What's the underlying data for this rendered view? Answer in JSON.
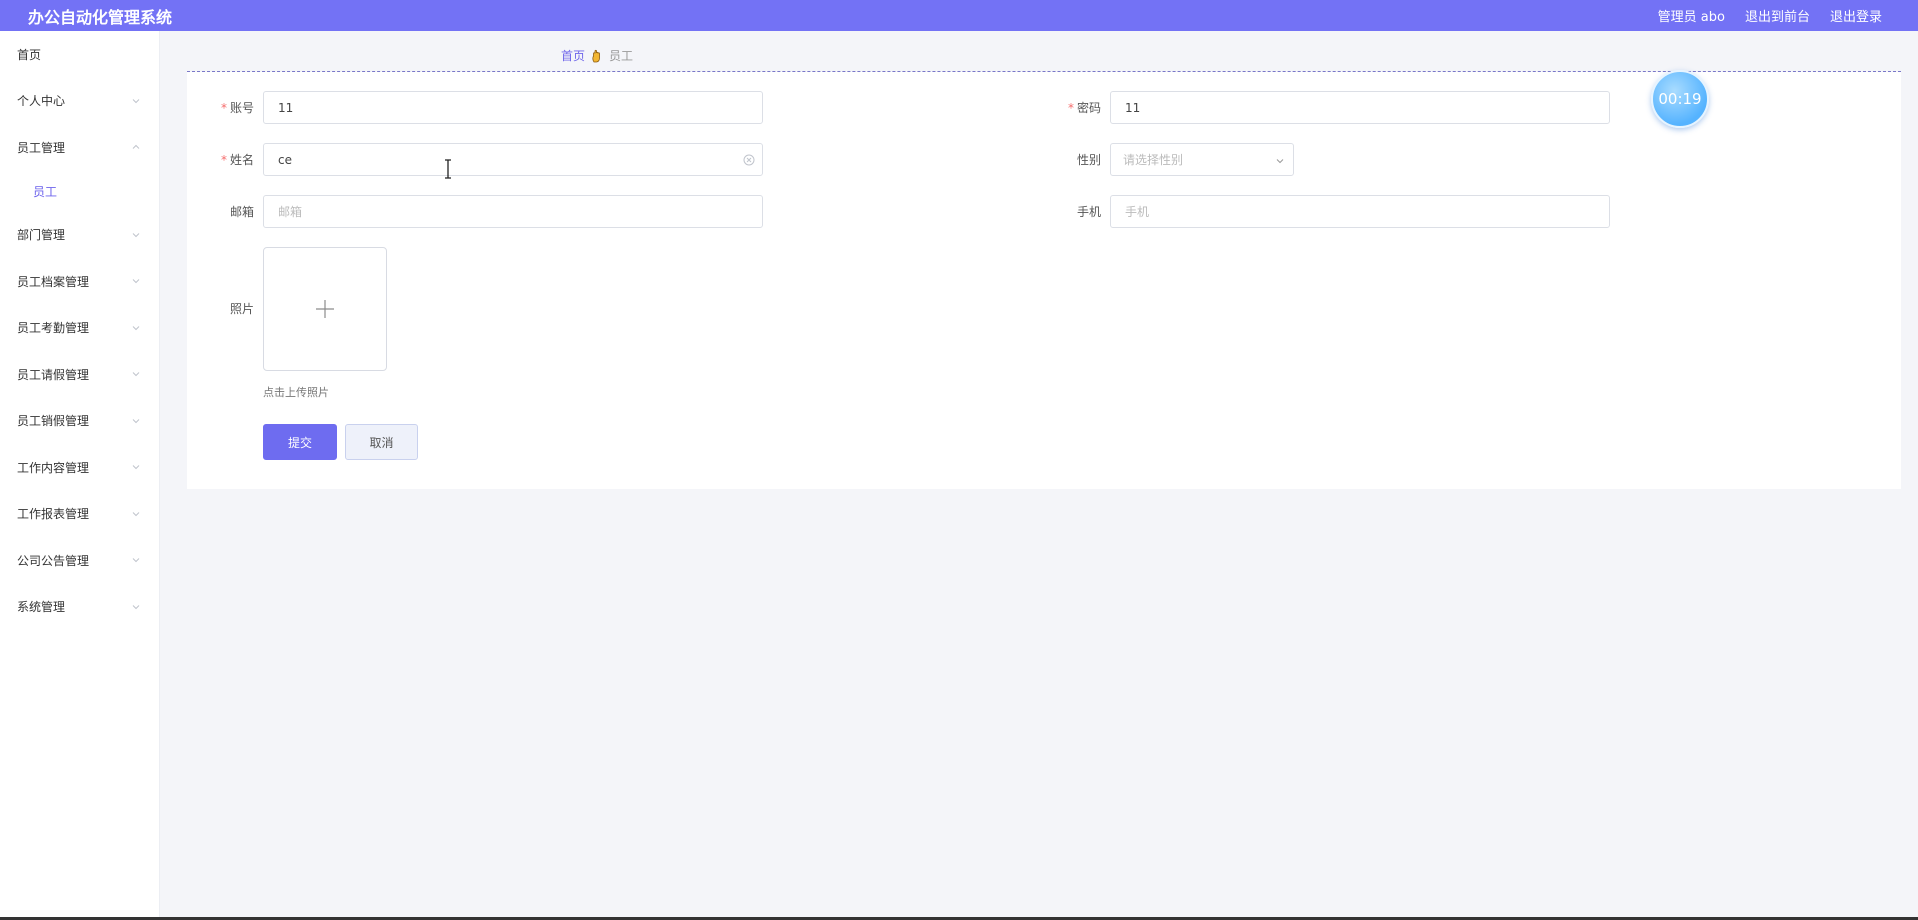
{
  "header": {
    "app_title": "办公自动化管理系统",
    "user_label": "管理员 abo",
    "to_frontend": "退出到前台",
    "logout": "退出登录"
  },
  "sidebar": {
    "items": [
      {
        "label": "首页",
        "chevron": "none"
      },
      {
        "label": "个人中心",
        "chevron": "down"
      },
      {
        "label": "员工管理",
        "chevron": "up"
      },
      {
        "label": "部门管理",
        "chevron": "down"
      },
      {
        "label": "员工档案管理",
        "chevron": "down"
      },
      {
        "label": "员工考勤管理",
        "chevron": "down"
      },
      {
        "label": "员工请假管理",
        "chevron": "down"
      },
      {
        "label": "员工销假管理",
        "chevron": "down"
      },
      {
        "label": "工作内容管理",
        "chevron": "down"
      },
      {
        "label": "工作报表管理",
        "chevron": "down"
      },
      {
        "label": "公司公告管理",
        "chevron": "down"
      },
      {
        "label": "系统管理",
        "chevron": "down"
      }
    ],
    "active_sub": "员工"
  },
  "breadcrumb": {
    "home": "首页",
    "current": "员工"
  },
  "form": {
    "account": {
      "label": "账号",
      "value": "11",
      "required": true
    },
    "password": {
      "label": "密码",
      "value": "11",
      "required": true
    },
    "name": {
      "label": "姓名",
      "value": "ce",
      "required": true
    },
    "gender": {
      "label": "性别",
      "placeholder": "请选择性别"
    },
    "email": {
      "label": "邮箱",
      "placeholder": "邮箱"
    },
    "phone": {
      "label": "手机",
      "placeholder": "手机"
    },
    "photo": {
      "label": "照片",
      "hint": "点击上传照片"
    },
    "submit": "提交",
    "cancel": "取消"
  },
  "timer": {
    "value": "00:19"
  },
  "colors": {
    "accent": "#7372f5",
    "submit": "#6e6cf0",
    "required": "#f56c6c",
    "timer": "#55b3ff"
  },
  "icons": {
    "breadcrumb_separator": "hand-icon",
    "clear": "circle-close-icon",
    "upload": "plus-icon",
    "select_arrow": "chevron-down-icon"
  }
}
